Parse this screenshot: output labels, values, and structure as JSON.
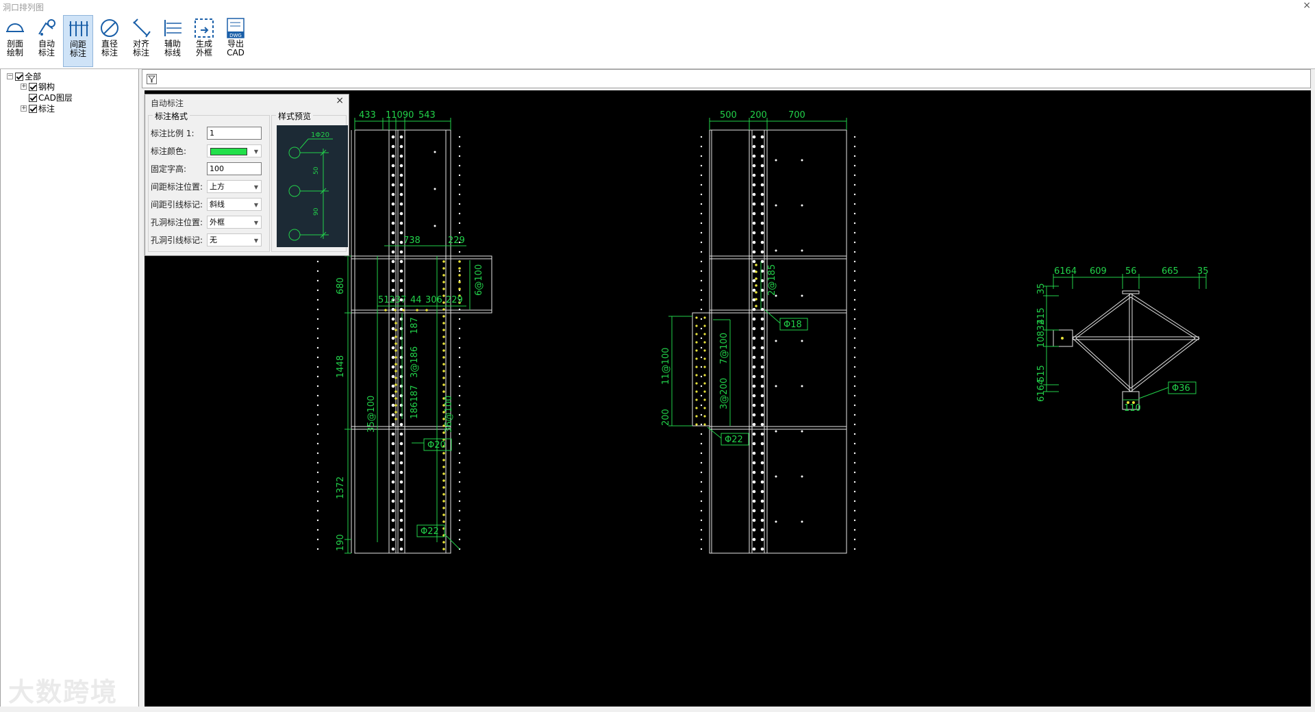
{
  "window": {
    "title": "洞口排列图",
    "close_glyph": "×"
  },
  "toolbar": {
    "buttons": [
      {
        "line1": "剖面",
        "line2": "绘制",
        "icon": "section-icon"
      },
      {
        "line1": "自动",
        "line2": "标注",
        "icon": "auto-dim-icon"
      },
      {
        "line1": "间距",
        "line2": "标注",
        "icon": "spacing-dim-icon",
        "active": true
      },
      {
        "line1": "直径",
        "line2": "标注",
        "icon": "diameter-icon"
      },
      {
        "line1": "对齐",
        "line2": "标注",
        "icon": "align-dim-icon"
      },
      {
        "line1": "辅助",
        "line2": "标线",
        "icon": "aux-line-icon"
      },
      {
        "line1": "生成",
        "line2": "外框",
        "icon": "outer-frame-icon"
      },
      {
        "line1": "导出",
        "line2": "CAD",
        "icon": "dwg-export-icon"
      }
    ],
    "dwg_badge": "DWG"
  },
  "tree": {
    "root": "全部",
    "children": [
      "钢构",
      "CAD图层",
      "标注"
    ],
    "expander_glyph": "−",
    "child_expander_glyph": "+"
  },
  "dialog": {
    "title": "自动标注",
    "group_format": "标注格式",
    "group_preview": "样式预览",
    "fields": {
      "scale_label": "标注比例 1:",
      "scale_value": "1",
      "color_label": "标注颜色:",
      "color_value": "#22e04a",
      "text_height_label": "固定字高:",
      "text_height_value": "100",
      "spacing_pos_label": "间距标注位置:",
      "spacing_pos_value": "上方",
      "spacing_leader_label": "间距引线标记:",
      "spacing_leader_value": "斜线",
      "hole_pos_label": "孔洞标注位置:",
      "hole_pos_value": "外框",
      "hole_leader_label": "孔洞引线标记:",
      "hole_leader_value": "无"
    },
    "preview_labels": {
      "dia": "1Φ20",
      "d1": "50",
      "d2": "90"
    }
  },
  "drawing": {
    "colors": {
      "dim": "#22d24a",
      "outline": "#e6e6e6",
      "hole_yellow": "#e8e23a",
      "background": "#000000"
    },
    "left_top_dims": [
      "433",
      "11090",
      "543"
    ],
    "left_mid_dims": [
      "738",
      "229"
    ],
    "left_row_dims": [
      "51237",
      "44",
      "306",
      "229"
    ],
    "left_side_dims": [
      "680",
      "1448",
      "1372",
      "190"
    ],
    "left_inner_dims": [
      "6@100",
      "187",
      "3@186",
      "186187",
      "35@100",
      "36@100"
    ],
    "left_callouts": [
      "Φ20",
      "Φ22"
    ],
    "mid_top_dims": [
      "500",
      "200",
      "700"
    ],
    "mid_inner_dims": [
      "2@185",
      "11@100",
      "7@100",
      "3@200",
      "200"
    ],
    "mid_callouts": [
      "Φ18",
      "Φ22"
    ],
    "right_top_dims": [
      "6164",
      "609",
      "56",
      "665",
      "35"
    ],
    "right_side_dims": [
      "35",
      "415",
      "10832",
      "515",
      "6164"
    ],
    "right_bottom_dim": "110",
    "right_callout": "Φ36"
  },
  "watermark": "大数跨境"
}
